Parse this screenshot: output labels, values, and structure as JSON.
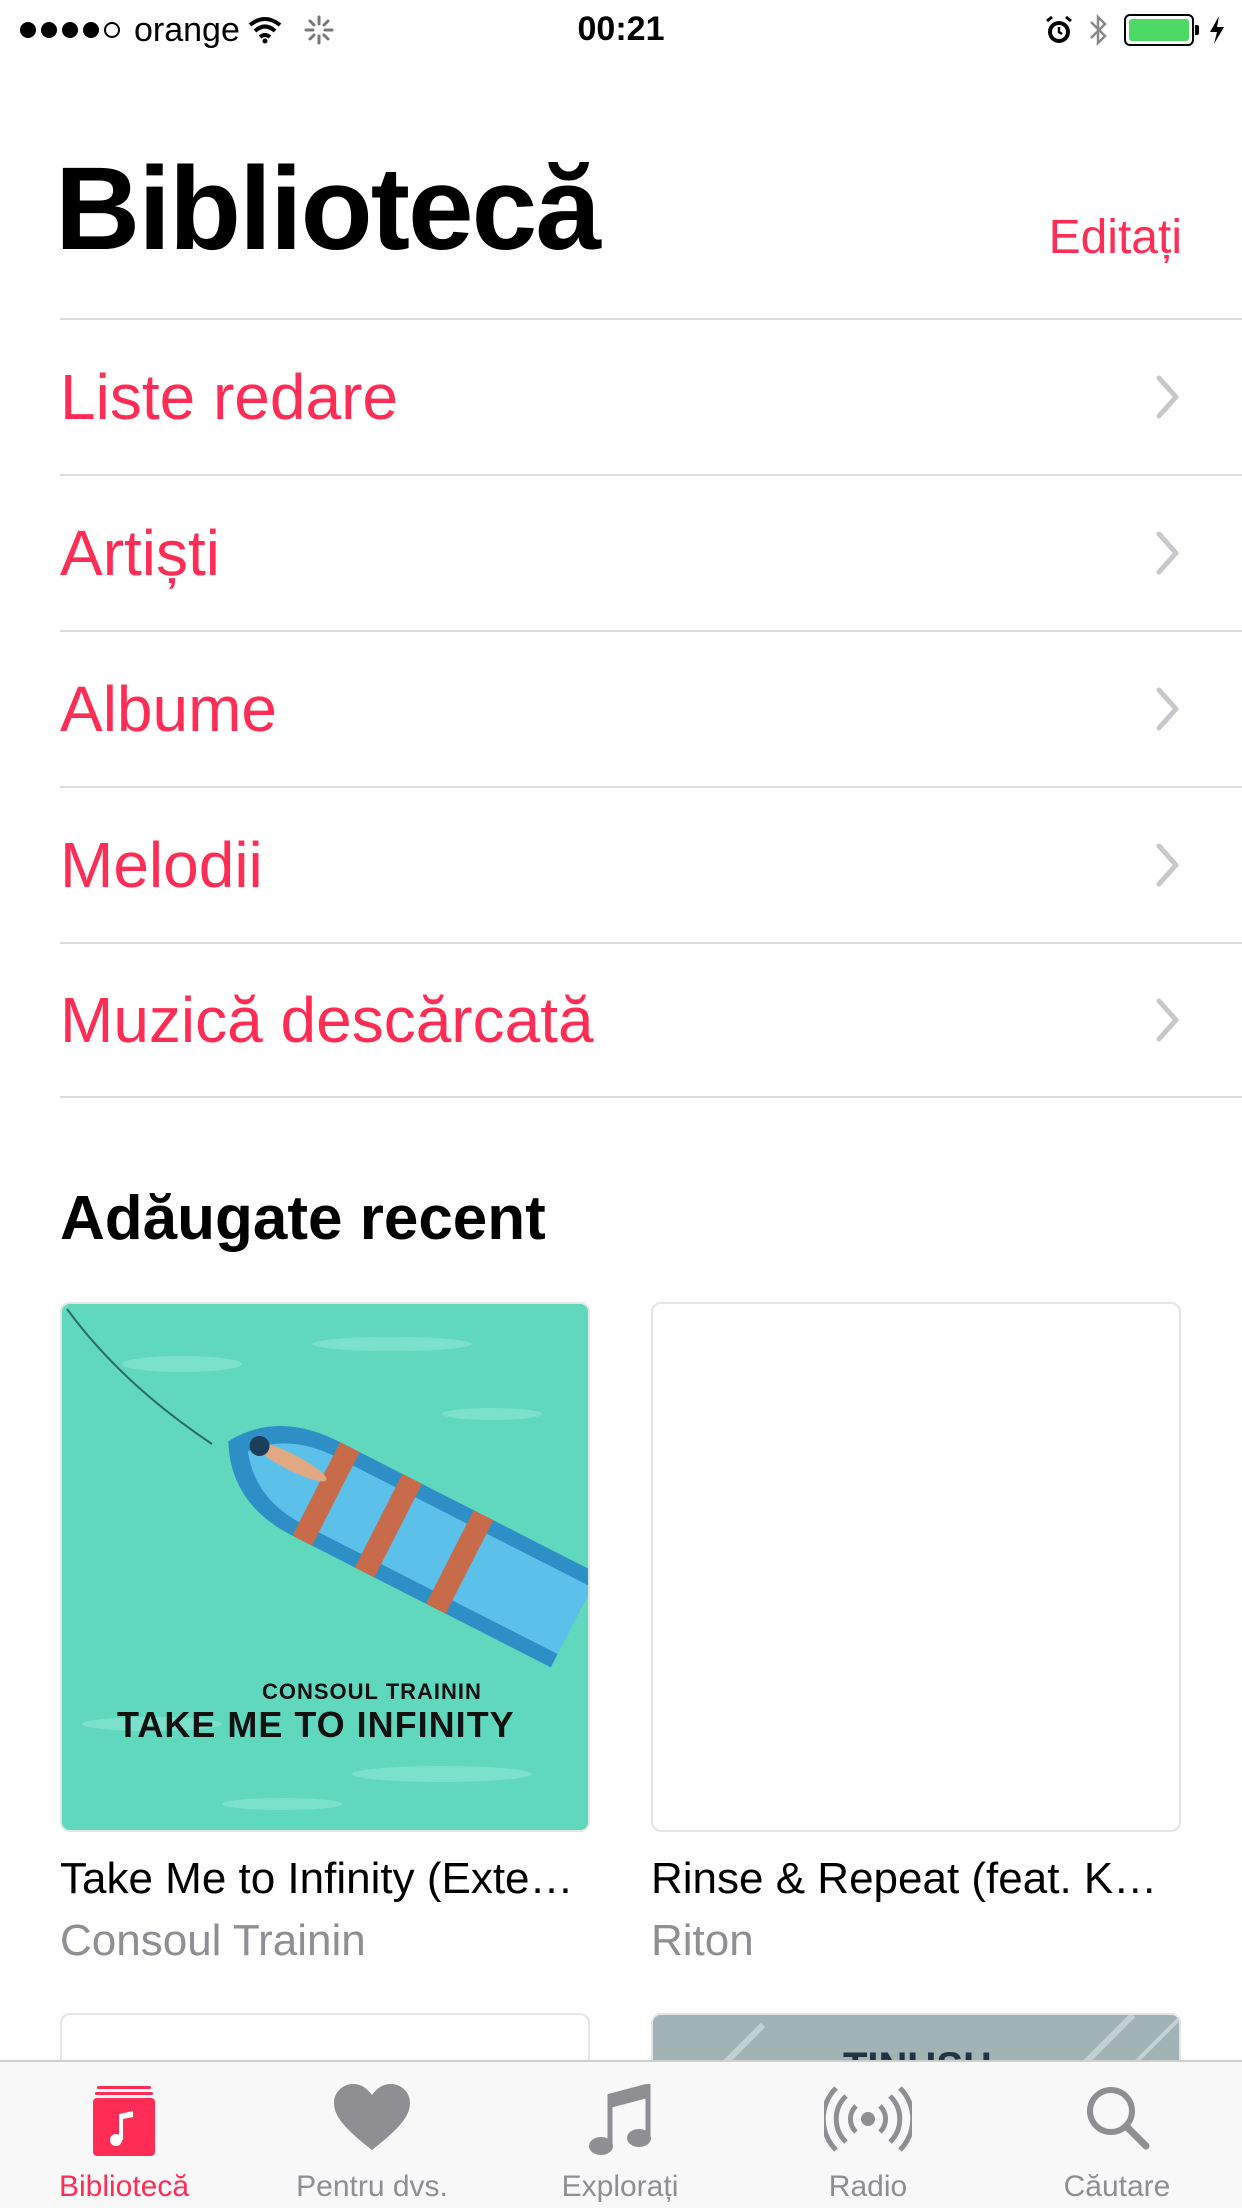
{
  "status_bar": {
    "carrier": "orange",
    "time": "00:21",
    "battery_level": 1.0
  },
  "header": {
    "title": "Bibliotecă",
    "edit_label": "Editați"
  },
  "library_items": [
    {
      "label": "Liste redare"
    },
    {
      "label": "Artiști"
    },
    {
      "label": "Albume"
    },
    {
      "label": "Melodii"
    },
    {
      "label": "Muzică descărcată"
    }
  ],
  "recent": {
    "title": "Adăugate recent",
    "albums": [
      {
        "title": "Take Me to Infinity (Exte…",
        "artist": "Consoul Trainin",
        "art_line_1": "CONSOUL TRAININ",
        "art_line_2": "TAKE ME TO INFINITY"
      },
      {
        "title": "Rinse & Repeat (feat. K…",
        "artist": "Riton"
      }
    ],
    "partial_art_text": "TINUSH"
  },
  "tab_bar": {
    "tabs": [
      {
        "label": "Bibliotecă",
        "icon": "library-icon",
        "active": true
      },
      {
        "label": "Pentru dvs.",
        "icon": "heart-icon"
      },
      {
        "label": "Explorați",
        "icon": "music-note-icon"
      },
      {
        "label": "Radio",
        "icon": "radio-icon"
      },
      {
        "label": "Căutare",
        "icon": "search-icon"
      }
    ]
  },
  "colors": {
    "accent": "#ff2d55",
    "secondary_text": "#8e8e93",
    "album_teal": "#5fd9bd",
    "battery": "#4cd964"
  }
}
